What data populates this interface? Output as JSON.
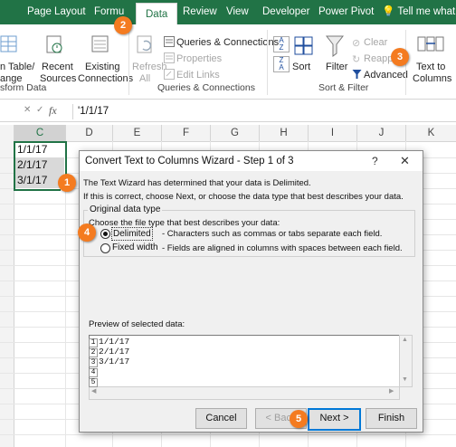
{
  "tabs": {
    "page_layout": "Page Layout",
    "formulas": "Formu",
    "data": "Data",
    "review": "Review",
    "view": "View",
    "developer": "Developer",
    "power_pivot": "Power Pivot",
    "tell_me": "Tell me what y"
  },
  "ribbon": {
    "from_table_1": "n Table/",
    "from_table_2": "ange",
    "recent_1": "Recent",
    "recent_2": "Sources",
    "existing_1": "Existing",
    "existing_2": "Connections",
    "transform_label": "sform Data",
    "refresh_1": "Refresh",
    "refresh_2": "All",
    "queries_connections": "Queries & Connections",
    "properties": "Properties",
    "edit_links": "Edit Links",
    "qc_group_label": "Queries & Connections",
    "sort_az_a": "A",
    "sort_az_z": "Z",
    "sort_za_z": "Z",
    "sort_za_a": "A",
    "sort": "Sort",
    "filter": "Filter",
    "clear": "Clear",
    "reapply": "Reapply",
    "advanced": "Advanced",
    "sort_filter_label": "Sort & Filter",
    "text_to_1": "Text to",
    "text_to_2": "Columns"
  },
  "formula_bar": {
    "fx": "fx",
    "value": "'1/1/17"
  },
  "columns": [
    "C",
    "D",
    "E",
    "F",
    "G",
    "H",
    "I",
    "J",
    "K"
  ],
  "cells": [
    "1/1/17",
    "2/1/17",
    "3/1/17"
  ],
  "dialog": {
    "title": "Convert Text to Columns Wizard - Step 1 of 3",
    "help": "?",
    "close": "✕",
    "line1": "The Text Wizard has determined that your data is Delimited.",
    "line2": "If this is correct, choose Next, or choose the data type that best describes your data.",
    "group_label": "Original data type",
    "choose_label": "Choose the file type that best describes your data:",
    "delimited_label": "Delimited",
    "delimited_desc": "- Characters such as commas or tabs separate each field.",
    "fixed_label": "Fixed width",
    "fixed_desc": "- Fields are aligned in columns with spaces between each field.",
    "preview_label": "Preview of selected data:",
    "preview_rows": [
      {
        "num": "1",
        "text": "1/1/17"
      },
      {
        "num": "2",
        "text": "2/1/17"
      },
      {
        "num": "3",
        "text": "3/1/17"
      },
      {
        "num": "4",
        "text": ""
      },
      {
        "num": "5",
        "text": ""
      }
    ],
    "cancel": "Cancel",
    "back": "< Back",
    "next": "Next >",
    "finish": "Finish"
  },
  "badges": [
    "1",
    "2",
    "3",
    "4",
    "5"
  ],
  "colors": {
    "accent": "#217346",
    "badge": "#f47b20",
    "focus": "#0078d7"
  }
}
